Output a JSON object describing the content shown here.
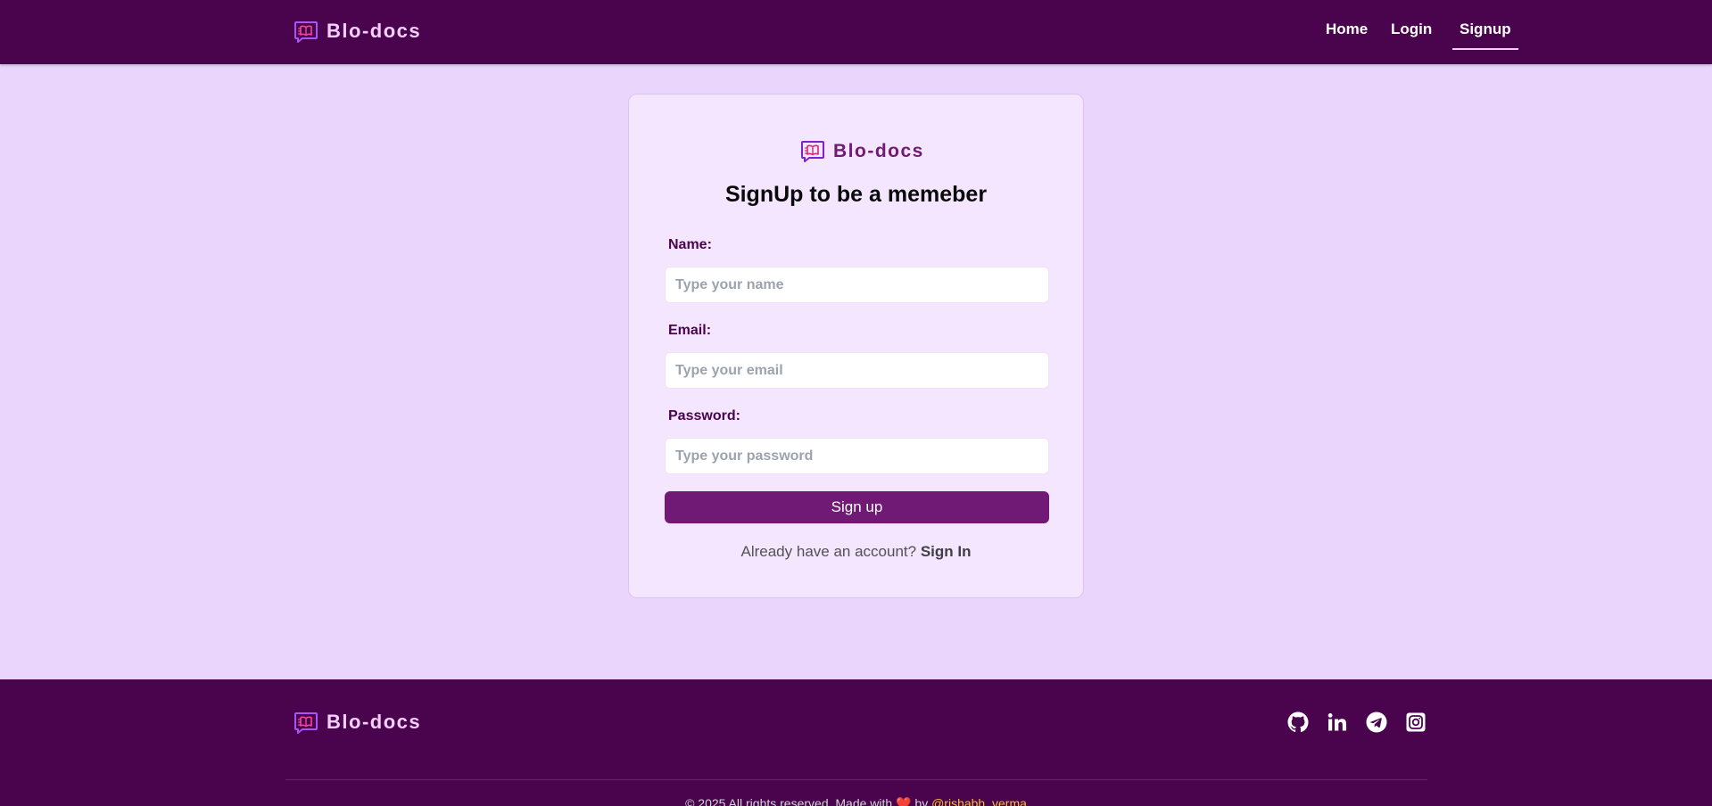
{
  "brand": {
    "name": "Blo-docs"
  },
  "nav": {
    "items": [
      {
        "label": "Home"
      },
      {
        "label": "Login"
      },
      {
        "label": "Signup",
        "active": true
      }
    ]
  },
  "signup": {
    "title": "SignUp to be a memeber",
    "fields": {
      "name": {
        "label": "Name:",
        "placeholder": "Type your name",
        "value": ""
      },
      "email": {
        "label": "Email:",
        "placeholder": "Type your email",
        "value": ""
      },
      "password": {
        "label": "Password:",
        "placeholder": "Type your password",
        "value": ""
      }
    },
    "submit_label": "Sign up",
    "account_prompt": "Already have an account?",
    "signin_label": "Sign In"
  },
  "footer": {
    "social": [
      "github-icon",
      "linkedin-icon",
      "telegram-icon",
      "instagram-icon"
    ],
    "copyright_prefix": "© 2025 All rights reserved. Made with",
    "heart": "❤️",
    "by": "by",
    "author": "@rishabh_verma"
  },
  "colors": {
    "header_bg": "#4a044e",
    "page_bg": "#ead5fc",
    "card_bg": "#f3e6fe",
    "accent": "#701a75",
    "brand_light": "#f5d0fe",
    "author_link": "#fbbf24"
  }
}
